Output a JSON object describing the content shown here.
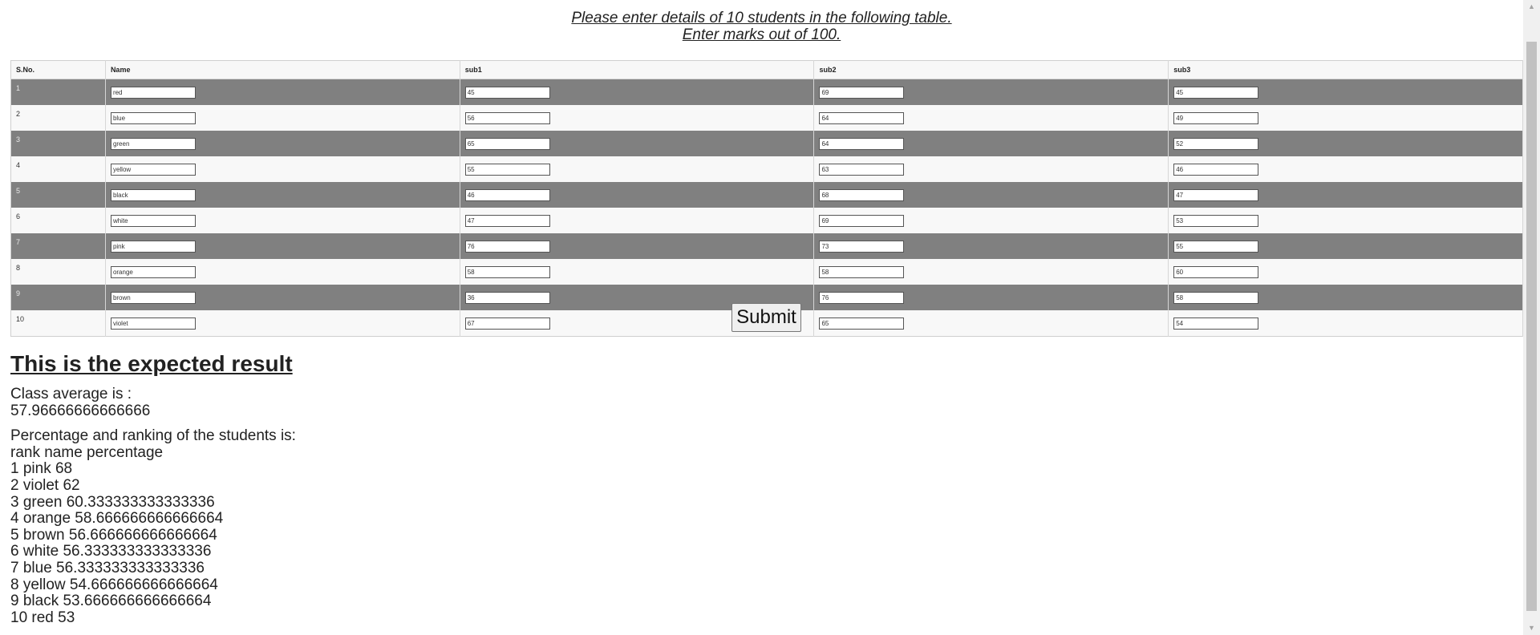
{
  "heading": {
    "line1": "Please enter details of 10 students in the following table.",
    "line2": "Enter marks out of 100."
  },
  "table": {
    "headers": [
      "S.No.",
      "Name",
      "sub1",
      "sub2",
      "sub3"
    ],
    "rows": [
      {
        "sno": "1",
        "name": "red",
        "sub1": "45",
        "sub2": "69",
        "sub3": "45"
      },
      {
        "sno": "2",
        "name": "blue",
        "sub1": "56",
        "sub2": "64",
        "sub3": "49"
      },
      {
        "sno": "3",
        "name": "green",
        "sub1": "65",
        "sub2": "64",
        "sub3": "52"
      },
      {
        "sno": "4",
        "name": "yellow",
        "sub1": "55",
        "sub2": "63",
        "sub3": "46"
      },
      {
        "sno": "5",
        "name": "black",
        "sub1": "46",
        "sub2": "68",
        "sub3": "47"
      },
      {
        "sno": "6",
        "name": "white",
        "sub1": "47",
        "sub2": "69",
        "sub3": "53"
      },
      {
        "sno": "7",
        "name": "pink",
        "sub1": "76",
        "sub2": "73",
        "sub3": "55"
      },
      {
        "sno": "8",
        "name": "orange",
        "sub1": "58",
        "sub2": "58",
        "sub3": "60"
      },
      {
        "sno": "9",
        "name": "brown",
        "sub1": "36",
        "sub2": "76",
        "sub3": "58"
      },
      {
        "sno": "10",
        "name": "violet",
        "sub1": "67",
        "sub2": "65",
        "sub3": "54"
      }
    ]
  },
  "submit_label": "Submit",
  "result": {
    "title": "This is the expected result",
    "avg_label": "Class average is :",
    "avg_value": "57.96666666666666",
    "ranking_label": "Percentage and ranking of the students is:",
    "ranking_header": "rank name percentage",
    "ranking": [
      "1 pink 68",
      "2 violet 62",
      "3 green 60.333333333333336",
      "4 orange 58.666666666666664",
      "5 brown 56.666666666666664",
      "6 white 56.333333333333336",
      "7 blue 56.333333333333336",
      "8 yellow 54.666666666666664",
      "9 black 53.666666666666664",
      "10 red 53"
    ]
  },
  "colors": {
    "odd_row": "#808080",
    "even_row": "#f8f8f8"
  },
  "icons": {
    "scroll_up": "scroll-up-arrow-icon",
    "scroll_down": "scroll-down-arrow-icon"
  }
}
